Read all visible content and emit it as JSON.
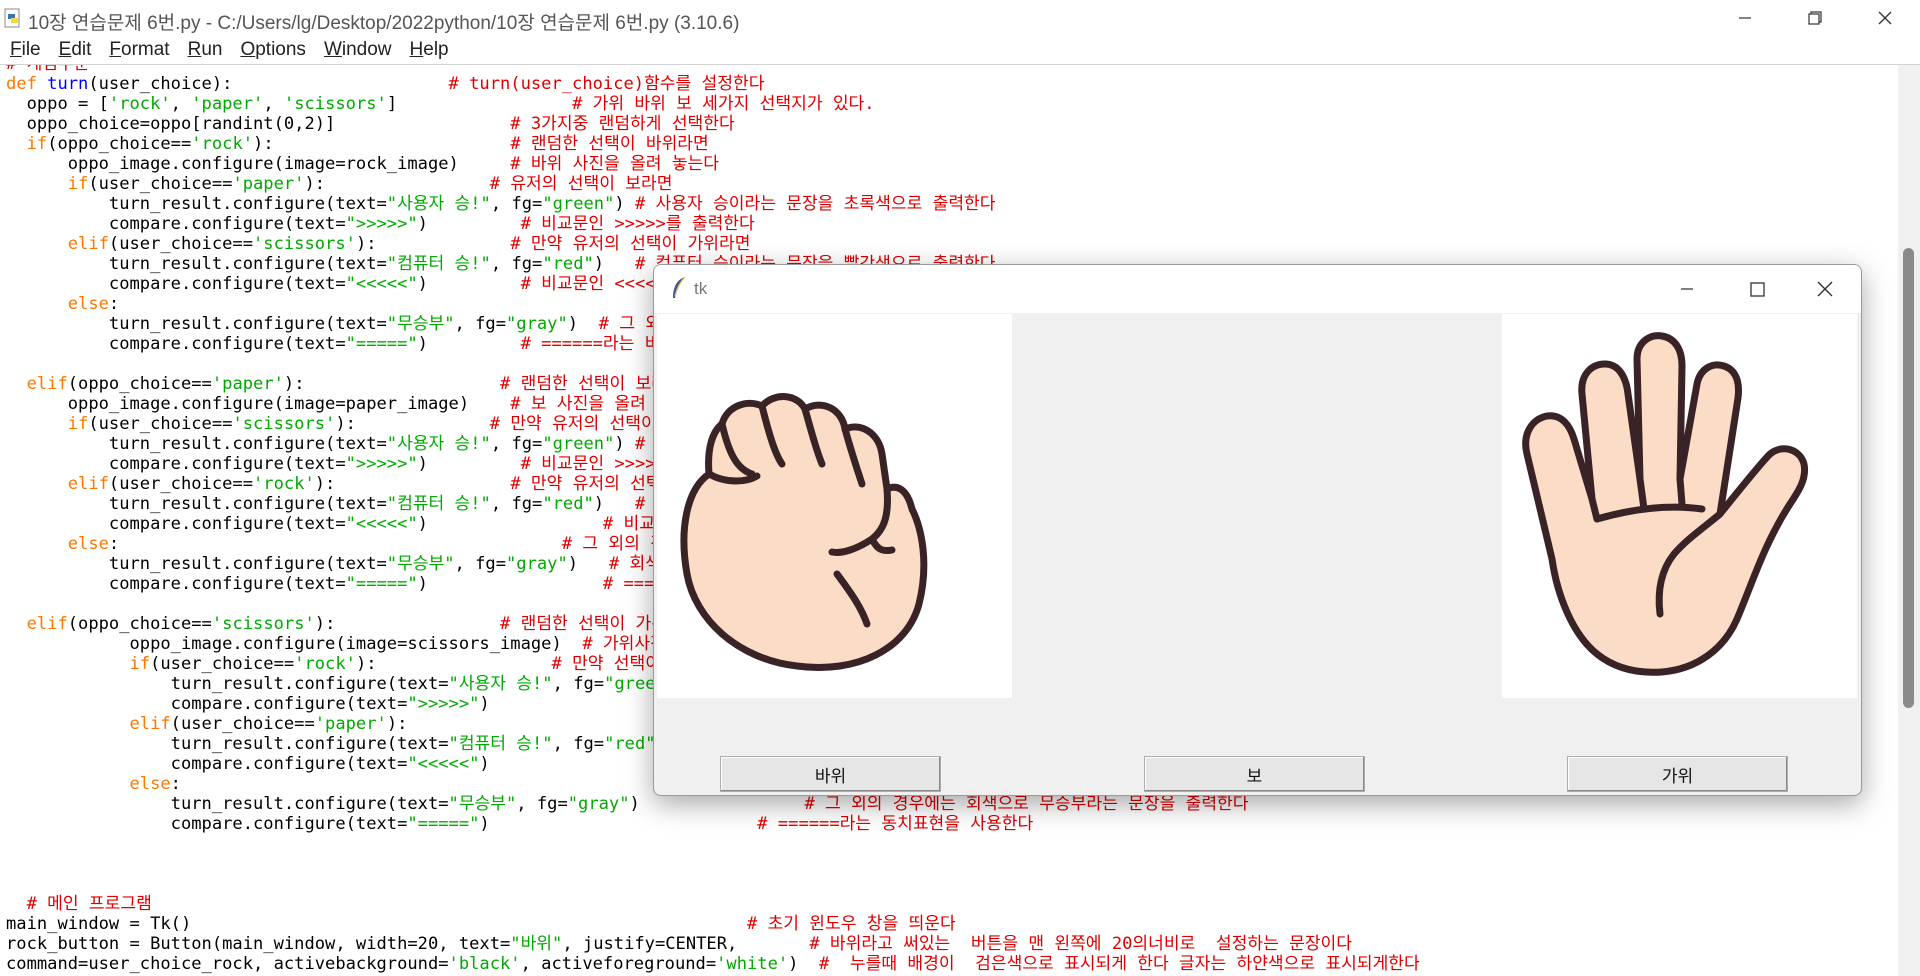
{
  "window": {
    "title": "10장 연습문제 6번.py - C:/Users/lg/Desktop/2022python/10장 연습문제 6번.py (3.10.6)"
  },
  "menu": {
    "items": [
      {
        "label": "File",
        "u": "F",
        "rest": "ile"
      },
      {
        "label": "Edit",
        "u": "E",
        "rest": "dit"
      },
      {
        "label": "Format",
        "u": "F",
        "rest": "ormat"
      },
      {
        "label": "Run",
        "u": "R",
        "rest": "un"
      },
      {
        "label": "Options",
        "u": "O",
        "rest": "ptions"
      },
      {
        "label": "Window",
        "u": "W",
        "rest": "indow"
      },
      {
        "label": "Help",
        "u": "H",
        "rest": "elp"
      }
    ]
  },
  "code": {
    "lines": [
      [
        [
          "cm",
          "# 게임부분"
        ]
      ],
      [
        [
          "kw",
          "def "
        ],
        [
          "def",
          "turn"
        ],
        [
          "",
          "(user_choice):                     "
        ],
        [
          "cm",
          "# turn(user_choice)함수를 설정한다"
        ]
      ],
      [
        [
          "",
          "  oppo = ["
        ],
        [
          "str",
          "'rock'"
        ],
        [
          "",
          ", "
        ],
        [
          "str",
          "'paper'"
        ],
        [
          "",
          ", "
        ],
        [
          "str",
          "'scissors'"
        ],
        [
          "",
          "]                 "
        ],
        [
          "cm",
          "# 가위 바위 보 세가지 선택지가 있다."
        ]
      ],
      [
        [
          "",
          "  oppo_choice=oppo[randint(0,2)]                 "
        ],
        [
          "cm",
          "# 3가지중 랜덤하게 선택한다"
        ]
      ],
      [
        [
          "",
          "  "
        ],
        [
          "kw",
          "if"
        ],
        [
          "",
          "(oppo_choice=="
        ],
        [
          "str",
          "'rock'"
        ],
        [
          "",
          "):                       "
        ],
        [
          "cm",
          "# 랜덤한 선택이 바위라면"
        ]
      ],
      [
        [
          "",
          "      oppo_image.configure(image=rock_image)     "
        ],
        [
          "cm",
          "# 바위 사진을 올려 놓는다"
        ]
      ],
      [
        [
          "",
          "      "
        ],
        [
          "kw",
          "if"
        ],
        [
          "",
          "(user_choice=="
        ],
        [
          "str",
          "'paper'"
        ],
        [
          "",
          "):                "
        ],
        [
          "cm",
          "# 유저의 선택이 보라면"
        ]
      ],
      [
        [
          "",
          "          turn_result.configure(text="
        ],
        [
          "str",
          "\"사용자 승!\""
        ],
        [
          "",
          ", fg="
        ],
        [
          "str",
          "\"green\""
        ],
        [
          "",
          ") "
        ],
        [
          "cm",
          "# 사용자 승이라는 문장을 초록색으로 출력한다"
        ]
      ],
      [
        [
          "",
          "          compare.configure(text="
        ],
        [
          "str",
          "\">>>>>\""
        ],
        [
          "",
          ")         "
        ],
        [
          "cm",
          "# 비교문인 >>>>>를 출력한다"
        ]
      ],
      [
        [
          "",
          "      "
        ],
        [
          "kw",
          "elif"
        ],
        [
          "",
          "(user_choice=="
        ],
        [
          "str",
          "'scissors'"
        ],
        [
          "",
          "):             "
        ],
        [
          "cm",
          "# 만약 유저의 선택이 가위라면"
        ]
      ],
      [
        [
          "",
          "          turn_result.configure(text="
        ],
        [
          "str",
          "\"컴퓨터 승!\""
        ],
        [
          "",
          ", fg="
        ],
        [
          "str",
          "\"red\""
        ],
        [
          "",
          ")   "
        ],
        [
          "cm",
          "# 컴퓨터 승이라는 문장을 빨간색으로 출력한다"
        ]
      ],
      [
        [
          "",
          "          compare.configure(text="
        ],
        [
          "str",
          "\"<<<<<\""
        ],
        [
          "",
          ")         "
        ],
        [
          "cm",
          "# 비교문인 <<<<<를 출력한다"
        ]
      ],
      [
        [
          "",
          "      "
        ],
        [
          "kw",
          "else"
        ],
        [
          "",
          ":"
        ]
      ],
      [
        [
          "",
          "          turn_result.configure(text="
        ],
        [
          "str",
          "\"무승부\""
        ],
        [
          "",
          ", fg="
        ],
        [
          "str",
          "\"gray\""
        ],
        [
          "",
          ")  "
        ],
        [
          "cm",
          "# 그 외의 경우에는 회색으로 무승부라는 문장을 출력한다"
        ]
      ],
      [
        [
          "",
          "          compare.configure(text="
        ],
        [
          "str",
          "\"=====\""
        ],
        [
          "",
          ")         "
        ],
        [
          "cm",
          "# ======라는 비교문을 출력한다"
        ]
      ],
      [
        [
          "",
          ""
        ]
      ],
      [
        [
          "",
          "  "
        ],
        [
          "kw",
          "elif"
        ],
        [
          "",
          "(oppo_choice=="
        ],
        [
          "str",
          "'paper'"
        ],
        [
          "",
          "):                   "
        ],
        [
          "cm",
          "# 랜덤한 선택이 보라면"
        ]
      ],
      [
        [
          "",
          "      oppo_image.configure(image=paper_image)    "
        ],
        [
          "cm",
          "# 보 사진을 올려 놓는다"
        ]
      ],
      [
        [
          "",
          "      "
        ],
        [
          "kw",
          "if"
        ],
        [
          "",
          "(user_choice=="
        ],
        [
          "str",
          "'scissors'"
        ],
        [
          "",
          "):             "
        ],
        [
          "cm",
          "# 만약 유저의 선택이 가위라면"
        ]
      ],
      [
        [
          "",
          "          turn_result.configure(text="
        ],
        [
          "str",
          "\"사용자 승!\""
        ],
        [
          "",
          ", fg="
        ],
        [
          "str",
          "\"green\""
        ],
        [
          "",
          ") "
        ],
        [
          "cm",
          "# 사용자 승이라는 문장을 초록색으로 출력한다"
        ]
      ],
      [
        [
          "",
          "          compare.configure(text="
        ],
        [
          "str",
          "\">>>>>\""
        ],
        [
          "",
          ")         "
        ],
        [
          "cm",
          "# 비교문인 >>>>>를 출력한다"
        ]
      ],
      [
        [
          "",
          "      "
        ],
        [
          "kw",
          "elif"
        ],
        [
          "",
          "(user_choice=="
        ],
        [
          "str",
          "'rock'"
        ],
        [
          "",
          "):                 "
        ],
        [
          "cm",
          "# 만약 유저의 선택이 바위라면"
        ]
      ],
      [
        [
          "",
          "          turn_result.configure(text="
        ],
        [
          "str",
          "\"컴퓨터 승!\""
        ],
        [
          "",
          ", fg="
        ],
        [
          "str",
          "\"red\""
        ],
        [
          "",
          ")   "
        ],
        [
          "cm",
          "# 컴퓨터 승이라는 문장을 빨간색으로 출력한다"
        ]
      ],
      [
        [
          "",
          "          compare.configure(text="
        ],
        [
          "str",
          "\"<<<<<\""
        ],
        [
          "",
          ")                 "
        ],
        [
          "cm",
          "# 비교문인 <<<<<를 출력한다"
        ]
      ],
      [
        [
          "",
          "      "
        ],
        [
          "kw",
          "else"
        ],
        [
          "",
          ":                                           "
        ],
        [
          "cm",
          "# 그 외의 경우에는"
        ]
      ],
      [
        [
          "",
          "          turn_result.configure(text="
        ],
        [
          "str",
          "\"무승부\""
        ],
        [
          "",
          ", fg="
        ],
        [
          "str",
          "\"gray\""
        ],
        [
          "",
          ")   "
        ],
        [
          "cm",
          "# 회색으로 무승부라는 문장을 출력한다"
        ]
      ],
      [
        [
          "",
          "          compare.configure(text="
        ],
        [
          "str",
          "\"=====\""
        ],
        [
          "",
          ")                 "
        ],
        [
          "cm",
          "# ======라는 비교문을 출력한다"
        ]
      ],
      [
        [
          "",
          ""
        ]
      ],
      [
        [
          "",
          "  "
        ],
        [
          "kw",
          "elif"
        ],
        [
          "",
          "(oppo_choice=="
        ],
        [
          "str",
          "'scissors'"
        ],
        [
          "",
          "):                "
        ],
        [
          "cm",
          "# 랜덤한 선택이 가위라면"
        ]
      ],
      [
        [
          "",
          "            oppo_image.configure(image=scissors_image)  "
        ],
        [
          "cm",
          "# 가위사진을 올려 놓는다"
        ]
      ],
      [
        [
          "",
          "            "
        ],
        [
          "kw",
          "if"
        ],
        [
          "",
          "(user_choice=="
        ],
        [
          "str",
          "'rock'"
        ],
        [
          "",
          "):                 "
        ],
        [
          "cm",
          "# 만약 선택이 바위라면"
        ]
      ],
      [
        [
          "",
          "                turn_result.configure(text="
        ],
        [
          "str",
          "\"사용자 승!\""
        ],
        [
          "",
          ", fg="
        ],
        [
          "str",
          "\"green\""
        ],
        [
          "",
          ")"
        ]
      ],
      [
        [
          "",
          "                compare.configure(text="
        ],
        [
          "str",
          "\">>>>>\""
        ],
        [
          "",
          ")"
        ]
      ],
      [
        [
          "",
          "            "
        ],
        [
          "kw",
          "elif"
        ],
        [
          "",
          "(user_choice=="
        ],
        [
          "str",
          "'paper'"
        ],
        [
          "",
          "):"
        ]
      ],
      [
        [
          "",
          "                turn_result.configure(text="
        ],
        [
          "str",
          "\"컴퓨터 승!\""
        ],
        [
          "",
          ", fg="
        ],
        [
          "str",
          "\"red\""
        ],
        [
          "",
          ")"
        ]
      ],
      [
        [
          "",
          "                compare.configure(text="
        ],
        [
          "str",
          "\"<<<<<\""
        ],
        [
          "",
          ")"
        ]
      ],
      [
        [
          "",
          "            "
        ],
        [
          "kw",
          "else"
        ],
        [
          "",
          ":"
        ]
      ],
      [
        [
          "",
          "                turn_result.configure(text="
        ],
        [
          "str",
          "\"무승부\""
        ],
        [
          "",
          ", fg="
        ],
        [
          "str",
          "\"gray\""
        ],
        [
          "",
          ")                "
        ],
        [
          "cm",
          "# 그 외의 경우에는 회색으로 무승부라는 문장을 출력한다"
        ]
      ],
      [
        [
          "",
          "                compare.configure(text="
        ],
        [
          "str",
          "\"=====\""
        ],
        [
          "",
          ")                          "
        ],
        [
          "cm",
          "# ======라는 동치표현을 사용한다"
        ]
      ],
      [
        [
          "",
          ""
        ]
      ],
      [
        [
          "",
          ""
        ]
      ],
      [
        [
          "",
          ""
        ]
      ],
      [
        [
          "",
          "  "
        ],
        [
          "cm",
          "# 메인 프로그램"
        ]
      ],
      [
        [
          "",
          "main_window = Tk()                                                      "
        ],
        [
          "cm",
          "# 초기 윈도우 창을 띄운다"
        ]
      ],
      [
        [
          "",
          "rock_button = Button(main_window, width=20, text="
        ],
        [
          "str",
          "\"바위\""
        ],
        [
          "",
          ", justify=CENTER,       "
        ],
        [
          "cm",
          "# 바위라고 써있는  버튼을 맨 왼쪽에 20의너비로  설정하는 문장이다"
        ]
      ],
      [
        [
          "",
          "command=user_choice_rock, activebackground="
        ],
        [
          "str",
          "'black'"
        ],
        [
          "",
          ", activeforeground="
        ],
        [
          "str",
          "'white'"
        ],
        [
          "",
          ")  "
        ],
        [
          "cm",
          "#  누를때 배경이  검은색으로 표시되게 한다 글자는 하얀색으로 표시되게한다"
        ]
      ]
    ]
  },
  "tk": {
    "title": "tk",
    "buttons": {
      "rock": "바위",
      "paper": "보",
      "scissors": "가위"
    }
  },
  "icons": {
    "minimize": "minimize-icon",
    "maximize": "maximize-icon",
    "close": "close-icon",
    "feather": "tk-feather-icon"
  },
  "colors": {
    "keyword": "#ff7700",
    "string": "#00aa00",
    "comment": "#dd0000",
    "skin": "#fbdcc6",
    "outline": "#3a2326"
  }
}
